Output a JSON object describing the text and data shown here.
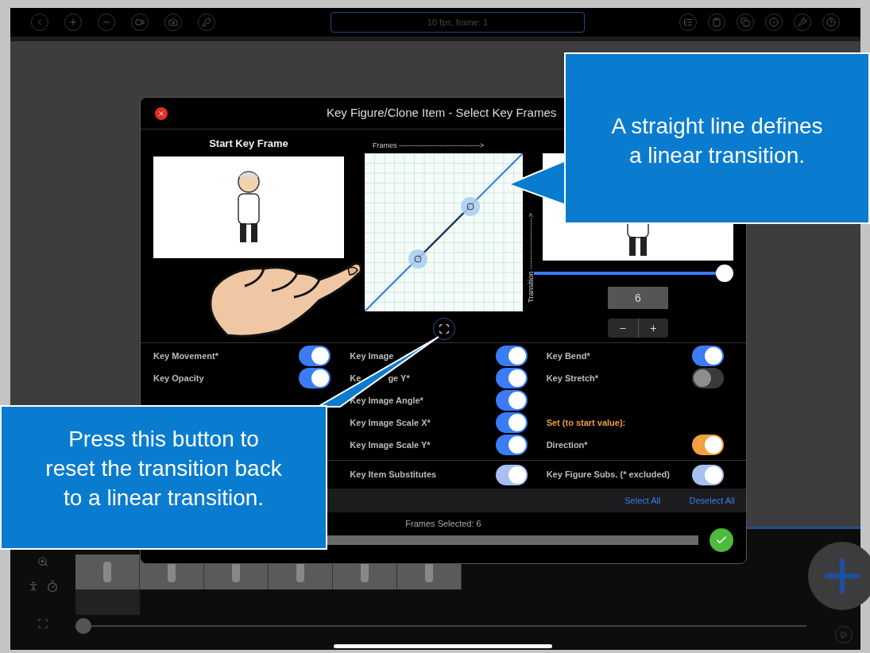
{
  "toolbar": {
    "status": "10 fps, frame: 1"
  },
  "dialog": {
    "title": "Key Figure/Clone Item - Select Key Frames",
    "start_frame_label": "Start Key Frame",
    "graph": {
      "x_label": "Frames ---------------------------------->",
      "y_label": "Transition ---------------------->"
    },
    "end_frame": {
      "slider": {
        "level": 1
      },
      "value": "6",
      "stepper": [
        "−",
        "+"
      ]
    },
    "columns": [
      [
        {
          "kind": "toggle",
          "label": [
            "Key Movement*"
          ],
          "on": true,
          "color": "#3b7cf5"
        },
        {
          "kind": "toggle",
          "label": [
            "Key Opacity"
          ],
          "on": true,
          "color": "#3b7cf5"
        }
      ],
      [
        {
          "kind": "toggle",
          "label": [
            "Key Image"
          ],
          "on": true,
          "color": "#3b7cf5"
        },
        {
          "kind": "toggle",
          "label": [
            "Ke",
            "ge Y*"
          ],
          "on": true,
          "color": "#3b7cf5"
        },
        {
          "kind": "toggle",
          "label": [
            "Key Image Angle*"
          ],
          "on": true,
          "color": "#3b7cf5"
        },
        {
          "kind": "toggle",
          "label": [
            "Key Image Scale X*"
          ],
          "on": true,
          "color": "#3b7cf5"
        },
        {
          "kind": "toggle",
          "label": [
            "Key Image Scale Y*"
          ],
          "on": true,
          "color": "#3b7cf5"
        }
      ],
      [
        {
          "kind": "toggle",
          "label": [
            "Key Bend*"
          ],
          "on": true,
          "color": "#3b7cf5"
        },
        {
          "kind": "toggle",
          "label": [
            "Key Stretch*"
          ],
          "on": false
        },
        {
          "kind": "heading",
          "label": [
            "Set (to start value):"
          ]
        },
        {
          "kind": "toggle",
          "label": [
            "Direction*"
          ],
          "on": true,
          "color": "#f0a03c"
        }
      ]
    ],
    "substitutes": [
      {
        "label": "Key Item Substitutes",
        "on": true,
        "color": "#a8c0f0"
      },
      {
        "label": "Key Figure Subs. (* excluded)",
        "on": true,
        "color": "#a8c0f0"
      }
    ],
    "links": [
      "Select All",
      "Deselect All"
    ],
    "frames_selected": "Frames Selected: 6",
    "frames_bar": {
      "level": 1
    }
  },
  "callouts": [
    {
      "lines": [
        "A straight line defines",
        "a linear transition."
      ]
    },
    {
      "lines": [
        "Press this button to",
        "reset the transition back",
        "to a linear transition."
      ]
    }
  ]
}
